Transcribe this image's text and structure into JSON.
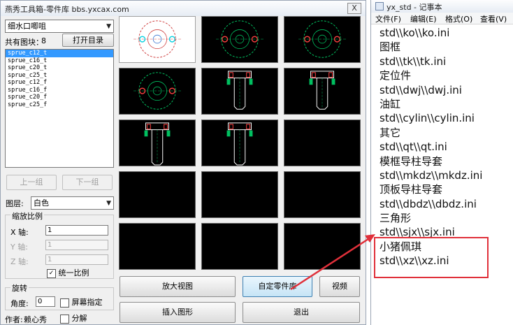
{
  "dialog": {
    "title": "燕秀工具箱-零件库  bbs.yxcax.com",
    "close_label": "X",
    "category_select": "细水口唧咀",
    "block_count_label": "共有图块：",
    "block_count": "8",
    "open_dir_button": "打开目录",
    "parts": [
      "sprue_c12_t",
      "sprue_c16_t",
      "sprue_c20_t",
      "sprue_c25_t",
      "sprue_c12_f",
      "sprue_c16_f",
      "sprue_c20_f",
      "sprue_c25_f"
    ],
    "selected_part_index": 0,
    "prev_group_button": "上一组",
    "next_group_button": "下一组",
    "layer_label": "图层:",
    "layer_select": "白色",
    "scale_group_label": "缩放比例",
    "x_axis_label": "X 轴:",
    "y_axis_label": "Y 轴:",
    "z_axis_label": "Z 轴:",
    "x_value": "1",
    "y_value": "1",
    "z_value": "1",
    "uniform_scale_label": "统一比例",
    "uniform_scale_checked": true,
    "rotate_group_label": "旋转",
    "angle_label": "角度:",
    "angle_value": "0",
    "screen_specify_label": "屏幕指定",
    "author_label": "作者:",
    "author_name": "赖心秀",
    "explode_label": "分解",
    "zoom_view_button": "放大视图",
    "custom_library_button": "自定零件库",
    "video_button": "视频",
    "insert_button": "插入图形",
    "exit_button": "退出"
  },
  "notepad": {
    "title": "yx_std - 记事本",
    "menu": [
      "文件(F)",
      "编辑(E)",
      "格式(O)",
      "查看(V)"
    ],
    "lines": [
      "std\\\\ko\\\\ko.ini",
      "图框",
      "std\\\\tk\\\\tk.ini",
      "定位件",
      "std\\\\dwj\\\\dwj.ini",
      "油缸",
      "std\\\\cylin\\\\cylin.ini",
      "其它",
      "std\\\\qt\\\\qt.ini",
      "模框导柱导套",
      "std\\\\mkdz\\\\mkdz.ini",
      "顶板导柱导套",
      "std\\\\dbdz\\\\dbdz.ini",
      "三角形",
      "std\\\\sjx\\\\sjx.ini",
      "小猪佩琪",
      "std\\\\xz\\\\xz.ini"
    ]
  },
  "colors": {
    "highlight": "#e0303a",
    "selection": "#3399ff",
    "cad_green": "#00c060",
    "cad_red": "#ff4040",
    "cad_cyan": "#00d0e0"
  }
}
